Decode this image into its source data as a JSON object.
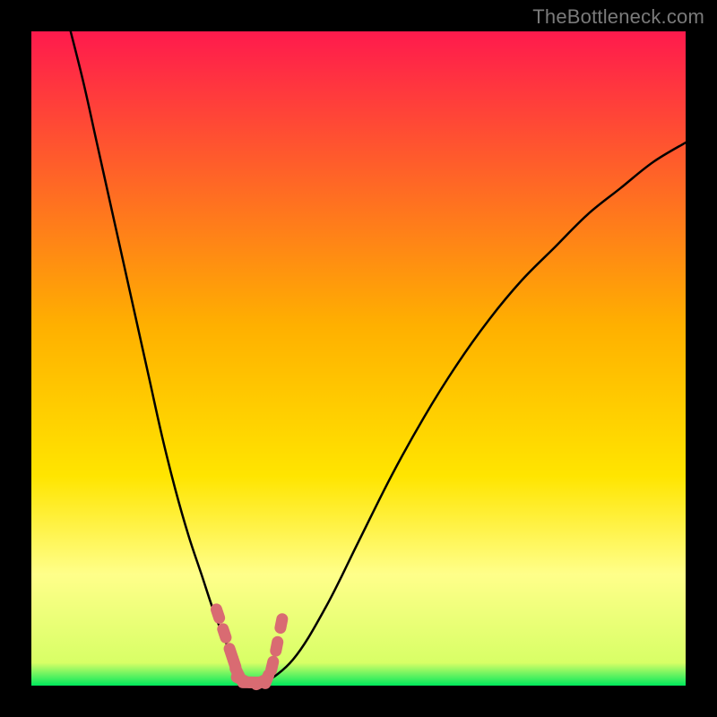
{
  "attribution": "TheBottleneck.com",
  "chart_data": {
    "type": "line",
    "title": "",
    "xlabel": "",
    "ylabel": "",
    "xlim": [
      0,
      100
    ],
    "ylim": [
      0,
      100
    ],
    "legend": false,
    "grid": false,
    "background_gradient": {
      "top_color": "#ff1a4d",
      "mid_color": "#ffd500",
      "lower_color": "#ffff8a",
      "bottom_color": "#00e85c"
    },
    "series": [
      {
        "name": "bottleneck-curve",
        "color": "#000000",
        "x": [
          6,
          8,
          10,
          12,
          14,
          16,
          18,
          20,
          22,
          24,
          26,
          28,
          30,
          31,
          32,
          33,
          34,
          35,
          40,
          45,
          50,
          55,
          60,
          65,
          70,
          75,
          80,
          85,
          90,
          95,
          100
        ],
        "y": [
          100,
          92,
          83,
          74,
          65,
          56,
          47,
          38,
          30,
          23,
          17,
          11,
          6,
          4,
          2,
          0,
          0,
          0,
          4,
          12,
          22,
          32,
          41,
          49,
          56,
          62,
          67,
          72,
          76,
          80,
          83
        ]
      },
      {
        "name": "optimal-range-marker",
        "color": "#d96b72",
        "style": "thick-dots",
        "x": [
          28.5,
          29.5,
          30.5,
          31.0,
          31.5,
          32.0,
          33.0,
          34.0,
          35.0,
          36.0,
          36.8,
          37.5,
          38.2
        ],
        "y": [
          11.0,
          8.0,
          5.0,
          3.5,
          2.0,
          1.0,
          0.5,
          0.5,
          0.5,
          1.0,
          3.0,
          6.0,
          9.5
        ]
      }
    ],
    "optimal_range_x": [
      31,
      36
    ],
    "curve_minimum": {
      "x": 33.5,
      "y": 0
    }
  }
}
